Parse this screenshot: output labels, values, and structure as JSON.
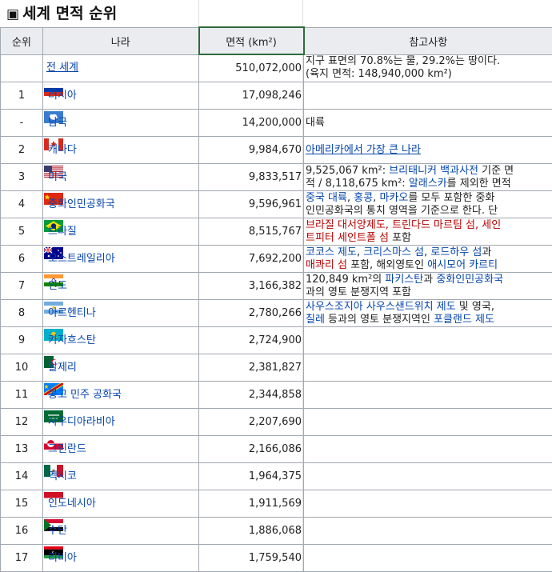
{
  "title": "세계 면적 순위",
  "title_marker": "▣",
  "headers": {
    "rank": "순위",
    "country": "나라",
    "area": "면적 (km²)",
    "notes": "참고사항"
  },
  "rows": [
    {
      "rank": "",
      "name": "전 세계",
      "area": "510,072,000",
      "flag": "none",
      "note": [
        [
          {
            "t": "지구 표면의 70.8%는 물, 29.2%는 땅이다."
          }
        ],
        [
          {
            "t": "(육지 면적: 148,940,000 km²)"
          }
        ]
      ]
    },
    {
      "rank": "1",
      "name": "러시아",
      "area": "17,098,246",
      "flag": "russia-flag-icon",
      "note": []
    },
    {
      "rank": "-",
      "name": "남극",
      "area": "14,200,000",
      "flag": "antarctica-flag-icon",
      "note": [
        [
          {
            "t": "대륙"
          }
        ]
      ]
    },
    {
      "rank": "2",
      "name": "캐나다",
      "area": "9,984,670",
      "flag": "canada-flag-icon",
      "note": [
        [
          {
            "t": "아메리카에서 가장 큰 나라",
            "c": "lk-u"
          }
        ]
      ]
    },
    {
      "rank": "3",
      "name": "미국",
      "area": "9,833,517",
      "flag": "usa-flag-icon",
      "note": [
        [
          {
            "t": "9,525,067 km²: "
          },
          {
            "t": "브리태니커 백과사전",
            "c": "lk"
          },
          {
            "t": " 기준 면"
          }
        ],
        [
          {
            "t": "적 / 8,118,675 km²: "
          },
          {
            "t": "알래스카",
            "c": "lk"
          },
          {
            "t": "를 제외한 면적"
          }
        ]
      ]
    },
    {
      "rank": "4",
      "name": "중화인민공화국",
      "area": "9,596,961",
      "flag": "china-flag-icon",
      "note": [
        [
          {
            "t": "중국 대륙",
            "c": "lk"
          },
          {
            "t": ", "
          },
          {
            "t": "홍콩",
            "c": "lk"
          },
          {
            "t": ", "
          },
          {
            "t": "마카오",
            "c": "lk"
          },
          {
            "t": "를 모두 포함한 중화"
          }
        ],
        [
          {
            "t": "인민공화국의 통치 영역을 기준으로 한다. 단"
          }
        ]
      ]
    },
    {
      "rank": "5",
      "name": "브라질",
      "area": "8,515,767",
      "flag": "brazil-flag-icon",
      "note": [
        [
          {
            "t": "브라질 대서양제도, 트린다드 마르팀 섬, 세인",
            "c": "red"
          }
        ],
        [
          {
            "t": "트피터 세인트폴 섬",
            "c": "red"
          },
          {
            "t": " 포함"
          }
        ]
      ]
    },
    {
      "rank": "6",
      "name": "오스트레일리아",
      "area": "7,692,200",
      "flag": "australia-flag-icon",
      "note": [
        [
          {
            "t": "코코스 제도",
            "c": "lk"
          },
          {
            "t": ", "
          },
          {
            "t": "크리스마스 섬",
            "c": "lk"
          },
          {
            "t": ", "
          },
          {
            "t": "로드하우 섬",
            "c": "lk"
          },
          {
            "t": "과"
          }
        ],
        [
          {
            "t": "매콰리 섬",
            "c": "red"
          },
          {
            "t": " 포함, 해외영토인 "
          },
          {
            "t": "애시모어 카르티",
            "c": "lk"
          }
        ]
      ]
    },
    {
      "rank": "7",
      "name": "인도",
      "area": "3,166,382",
      "flag": "india-flag-icon",
      "note": [
        [
          {
            "t": "120,849 km²의 "
          },
          {
            "t": "파키스탄",
            "c": "lk"
          },
          {
            "t": "과 "
          },
          {
            "t": "중화인민공화국",
            "c": "lk"
          }
        ],
        [
          {
            "t": "과의 영토 분쟁지역 포함"
          }
        ]
      ]
    },
    {
      "rank": "8",
      "name": "아르헨티나",
      "area": "2,780,266",
      "flag": "argentina-flag-icon",
      "note": [
        [
          {
            "t": "사우스조지아 사우스샌드위치 제도",
            "c": "lk"
          },
          {
            "t": " 및 영국,"
          }
        ],
        [
          {
            "t": "칠레",
            "c": "lk"
          },
          {
            "t": " 등과의 영토 분쟁지역인 "
          },
          {
            "t": "포클랜드 제도",
            "c": "lk"
          }
        ]
      ]
    },
    {
      "rank": "9",
      "name": "카자흐스탄",
      "area": "2,724,900",
      "flag": "kazakhstan-flag-icon",
      "note": []
    },
    {
      "rank": "10",
      "name": "알제리",
      "area": "2,381,827",
      "flag": "algeria-flag-icon",
      "note": []
    },
    {
      "rank": "11",
      "name": "콩고 민주 공화국",
      "area": "2,344,858",
      "flag": "drc-flag-icon",
      "note": []
    },
    {
      "rank": "12",
      "name": "사우디아라비아",
      "area": "2,207,690",
      "flag": "saudi-flag-icon",
      "note": []
    },
    {
      "rank": "13",
      "name": "그린란드",
      "area": "2,166,086",
      "flag": "greenland-flag-icon",
      "note": []
    },
    {
      "rank": "14",
      "name": "멕시코",
      "area": "1,964,375",
      "flag": "mexico-flag-icon",
      "note": []
    },
    {
      "rank": "15",
      "name": "인도네시아",
      "area": "1,911,569",
      "flag": "indonesia-flag-icon",
      "note": []
    },
    {
      "rank": "16",
      "name": "수단",
      "area": "1,886,068",
      "flag": "sudan-flag-icon",
      "note": []
    },
    {
      "rank": "17",
      "name": "리비아",
      "area": "1,759,540",
      "flag": "libya-flag-icon",
      "note": []
    }
  ],
  "colors": {
    "link": "#0645ad",
    "redlink": "#ba0000",
    "header_bg": "#eaecf0",
    "border": "#a2a9b1",
    "selected_border": "#2e6b3a"
  }
}
